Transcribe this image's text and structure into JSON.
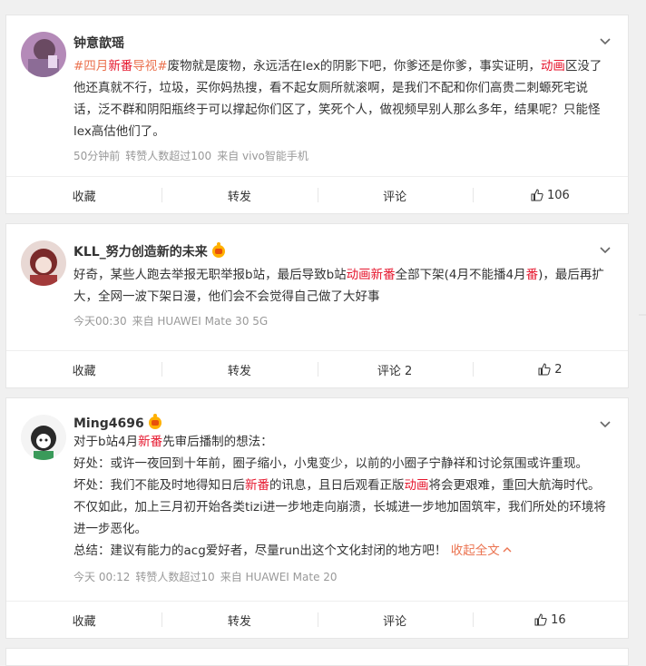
{
  "posts": [
    {
      "username": "钟意歆瑶",
      "has_vip_badge": false,
      "content": {
        "topic_prefix": "#四月",
        "topic_hl": "新番",
        "topic_suffix": "导视#",
        "t1": "废物就是废物，永远活在lex的阴影下吧，你爹还是你爹，事实证明，",
        "hl1": "动画",
        "t2": "区没了他还真就不行，垃圾，买你妈热搜，看不起女厕所就滚啊，是我们不配和你们高贵二刺螈死宅说话，泛不群和阴阳瓶终于可以撑起你们区了，笑死个人，做视频早别人那么多年，结果呢？只能怪lex高估他们了。"
      },
      "meta": {
        "time": "50分钟前",
        "repost_count_text": "转赞人数超过100",
        "source": "来自 vivo智能手机"
      },
      "actions": {
        "collect": "收藏",
        "repost": "转发",
        "comment": "评论",
        "like_count": "106"
      }
    },
    {
      "username": "KLL_努力创造新的未来",
      "has_vip_badge": true,
      "content": {
        "t1": "好奇，某些人跑去举报无职举报b站，最后导致b站",
        "hl1": "动画",
        "hl2": "新番",
        "t2": "全部下架(4月不能播4月",
        "hl3": "番",
        "t3": ")，最后再扩大，全网一波下架日漫，他们会不会觉得自己做了大好事"
      },
      "meta": {
        "time": "今天00:30",
        "source": "来自 HUAWEI Mate 30 5G"
      },
      "actions": {
        "collect": "收藏",
        "repost": "转发",
        "comment": "评论 2",
        "like_count": "2"
      }
    },
    {
      "username": "Ming4696",
      "has_vip_badge": true,
      "content": {
        "l1a": "对于b站4月",
        "l1hl": "新番",
        "l1b": "先审后播制的想法：",
        "l2": "好处：或许一夜回到十年前，圈子缩小，小鬼变少，以前的小圈子宁静祥和讨论氛围或许重现。",
        "l3a": "坏处：我们不能及时地得知日后",
        "l3hl1": "新番",
        "l3b": "的讯息，且日后观看正版",
        "l3hl2": "动画",
        "l3c": "将会更艰难，重回大航海时代。不仅如此，加上三月初开始各类tizi进一步地走向崩溃，长城进一步地加固筑牢，我们所处的环境将进一步恶化。",
        "l4": "总结：建议有能力的acg爱好者，尽量run出这个文化封闭的地方吧！",
        "collapse": "收起全文",
        "collapse_icon": "chevron-up-icon"
      },
      "meta": {
        "time": "今天 00:12",
        "repost_count_text": "转赞人数超过10",
        "source": "来自 HUAWEI Mate 20"
      },
      "actions": {
        "collect": "收藏",
        "repost": "转发",
        "comment": "评论",
        "like_count": "16"
      }
    }
  ],
  "colors": {
    "highlight": "#e6162d",
    "link": "#eb7350",
    "meta": "#999999",
    "background": "#f0f0f0"
  }
}
